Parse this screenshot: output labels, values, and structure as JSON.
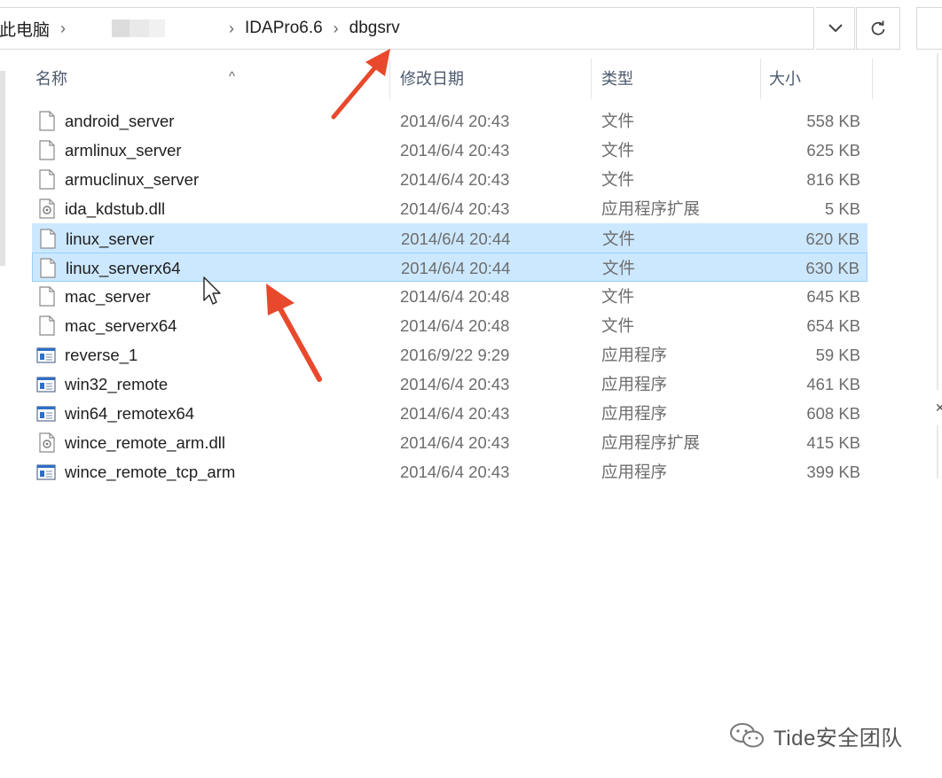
{
  "address": {
    "crumbs": [
      "此电脑",
      "IDAPro6.6",
      "dbgsrv"
    ],
    "separator": "›"
  },
  "columns": {
    "name": "名称",
    "date": "修改日期",
    "type": "类型",
    "size": "大小"
  },
  "files": [
    {
      "name": "android_server",
      "date": "2014/6/4 20:43",
      "type": "文件",
      "size": "558 KB",
      "icon": "blank-file-icon"
    },
    {
      "name": "armlinux_server",
      "date": "2014/6/4 20:43",
      "type": "文件",
      "size": "625 KB",
      "icon": "blank-file-icon"
    },
    {
      "name": "armuclinux_server",
      "date": "2014/6/4 20:43",
      "type": "文件",
      "size": "816 KB",
      "icon": "blank-file-icon"
    },
    {
      "name": "ida_kdstub.dll",
      "date": "2014/6/4 20:43",
      "type": "应用程序扩展",
      "size": "5 KB",
      "icon": "dll-file-icon"
    },
    {
      "name": "linux_server",
      "date": "2014/6/4 20:44",
      "type": "文件",
      "size": "620 KB",
      "icon": "blank-file-icon",
      "selected": true
    },
    {
      "name": "linux_serverx64",
      "date": "2014/6/4 20:44",
      "type": "文件",
      "size": "630 KB",
      "icon": "blank-file-icon",
      "selected": true,
      "focused": true
    },
    {
      "name": "mac_server",
      "date": "2014/6/4 20:48",
      "type": "文件",
      "size": "645 KB",
      "icon": "blank-file-icon"
    },
    {
      "name": "mac_serverx64",
      "date": "2014/6/4 20:48",
      "type": "文件",
      "size": "654 KB",
      "icon": "blank-file-icon"
    },
    {
      "name": "reverse_1",
      "date": "2016/9/22 9:29",
      "type": "应用程序",
      "size": "59 KB",
      "icon": "exe-file-icon"
    },
    {
      "name": "win32_remote",
      "date": "2014/6/4 20:43",
      "type": "应用程序",
      "size": "461 KB",
      "icon": "exe-file-icon"
    },
    {
      "name": "win64_remotex64",
      "date": "2014/6/4 20:43",
      "type": "应用程序",
      "size": "608 KB",
      "icon": "exe-file-icon"
    },
    {
      "name": "wince_remote_arm.dll",
      "date": "2014/6/4 20:43",
      "type": "应用程序扩展",
      "size": "415 KB",
      "icon": "dll-file-icon"
    },
    {
      "name": "wince_remote_tcp_arm",
      "date": "2014/6/4 20:43",
      "type": "应用程序",
      "size": "399 KB",
      "icon": "exe-file-icon"
    }
  ],
  "watermark": "Tide安全团队",
  "colors": {
    "selection": "#cce8ff",
    "selection_border": "#99d1ff",
    "arrow": "#e8492c"
  }
}
